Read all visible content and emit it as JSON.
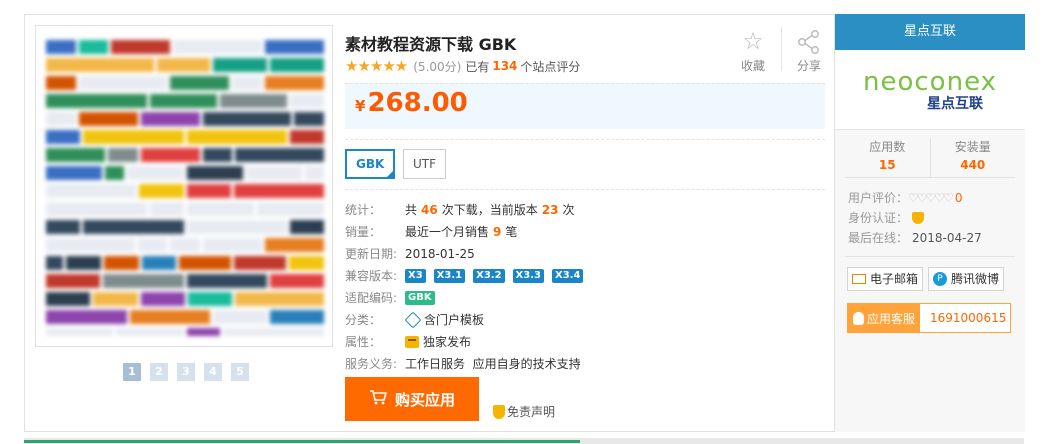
{
  "product": {
    "title": "素材教程资源下载 GBK",
    "stars": "★★★★★",
    "score": "(5.00分)",
    "rating_prefix": "已有",
    "rating_count": "134",
    "rating_suffix": "个站点评分",
    "price_currency": "¥",
    "price": "268.00"
  },
  "actions": {
    "favorite_label": "收藏",
    "share_label": "分享",
    "favorite_icon": "star-outline-icon",
    "share_icon": "share-icon"
  },
  "encodings": [
    "GBK",
    "UTF"
  ],
  "gallery": {
    "pages": [
      "1",
      "2",
      "3",
      "4",
      "5"
    ],
    "active_page": "1"
  },
  "specs": {
    "stats_label": "统计：",
    "stats_prefix": "共",
    "stats_downloads": "46",
    "stats_mid": "次下载，当前版本",
    "stats_version_downloads": "23",
    "stats_suffix": "次",
    "sales_label": "销量：",
    "sales_prefix": "最近一个月销售",
    "sales_count": "9",
    "sales_suffix": "笔",
    "updated_label": "更新日期:",
    "updated_value": "2018-01-25",
    "compat_label": "兼容版本:",
    "compat_versions": [
      "X3",
      "X3.1",
      "X3.2",
      "X3.3",
      "X3.4"
    ],
    "encoding_label": "适配编码:",
    "encoding_value": "GBK",
    "category_label": "分类：",
    "category_value": "含门户模板",
    "attribute_label": "属性：",
    "attribute_value": "独家发布",
    "service_label": "服务义务:",
    "service_value": "工作日服务  应用自身的技术支持"
  },
  "buy": {
    "label": "购买应用",
    "disclaimer": "免责声明"
  },
  "vendor": {
    "name": "星点互联",
    "logo_word": "neoconex",
    "logo_cn": "星点互联",
    "apps_label": "应用数",
    "apps_value": "15",
    "installs_label": "安装量",
    "installs_value": "440",
    "rating_label": "用户评价：",
    "rating_hearts": "♡♡♡♡♡",
    "rating_value": "0",
    "verify_label": "身份认证：",
    "last_online_label": "最后在线：",
    "last_online_value": "2018-04-27",
    "email_label": "电子邮箱",
    "weibo_label": "腾讯微博",
    "service_label": "应用客服",
    "service_number": "1691000615"
  },
  "colors": {
    "accent_blue": "#2b8fc3",
    "price_orange": "#ff5a00",
    "buy_orange": "#ff6a00"
  }
}
